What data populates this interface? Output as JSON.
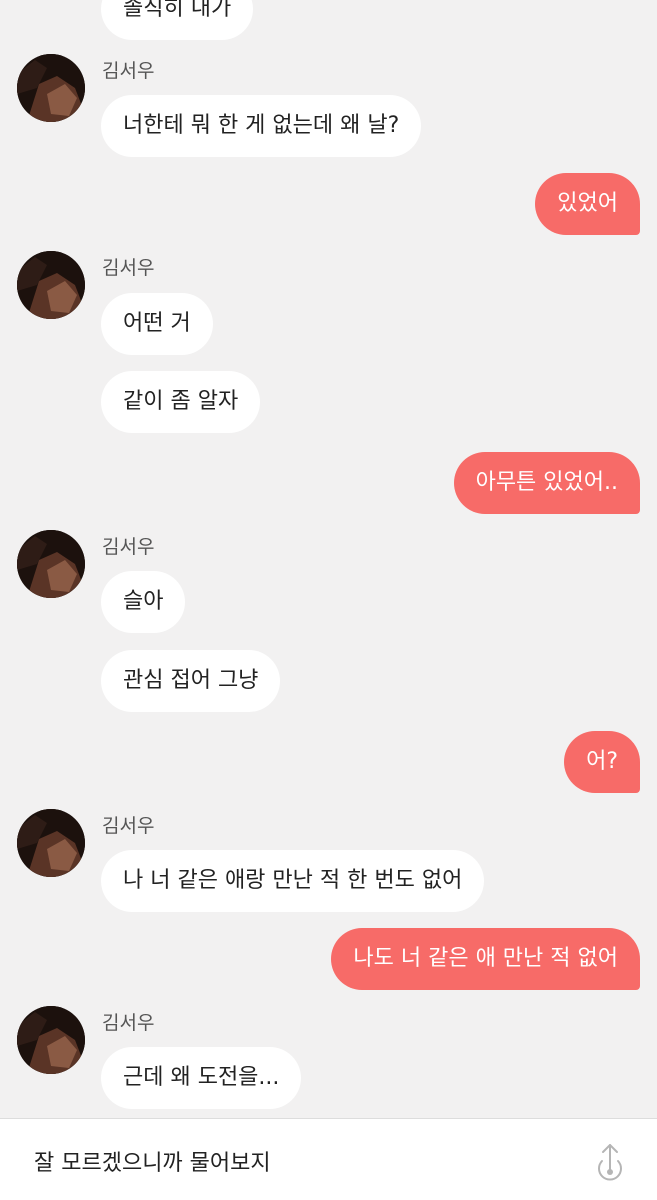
{
  "messages": [
    {
      "type": "in",
      "sender": "",
      "text": "솔직히 내가"
    },
    {
      "type": "in",
      "sender": "김서우",
      "text": "너한테 뭐 한 게 없는데 왜 날?"
    },
    {
      "type": "out",
      "text": "있었어"
    },
    {
      "type": "in",
      "sender": "김서우",
      "text": "어떤 거"
    },
    {
      "type": "in",
      "sender": "",
      "text": "같이 좀 알자"
    },
    {
      "type": "out",
      "text": "아무튼 있었어.."
    },
    {
      "type": "in",
      "sender": "김서우",
      "text": "슬아"
    },
    {
      "type": "in",
      "sender": "",
      "text": "관심 접어 그냥"
    },
    {
      "type": "out",
      "text": "어?"
    },
    {
      "type": "in",
      "sender": "김서우",
      "text": "나 너 같은 애랑 만난 적 한 번도 없어"
    },
    {
      "type": "out",
      "text": "나도 너 같은 애 만난 적 없어"
    },
    {
      "type": "in",
      "sender": "김서우",
      "text": "근데 왜 도전을..."
    }
  ],
  "input": {
    "text": "잘 모르겠으니까 물어보지",
    "send_icon": "send-arrow-icon"
  },
  "colors": {
    "background": "#f2f1f1",
    "incoming_bubble": "#ffffff",
    "outgoing_bubble": "#f76b68",
    "outgoing_text": "#ffffff"
  }
}
